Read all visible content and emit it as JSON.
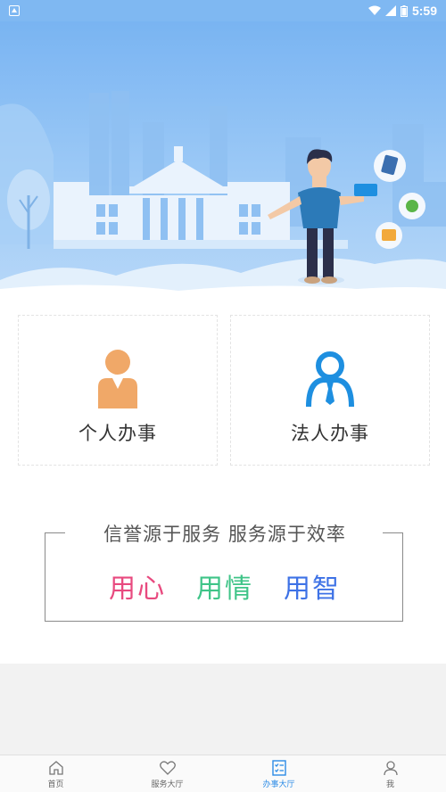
{
  "status_bar": {
    "time": "5:59"
  },
  "cards": [
    {
      "label": "个人办事",
      "icon": "person-icon",
      "color": "#f0a868"
    },
    {
      "label": "法人办事",
      "icon": "corporate-person-icon",
      "color": "#1e8fe0"
    }
  ],
  "slogan": {
    "title": "信誉源于服务 服务源于效率",
    "words": [
      {
        "text": "用心",
        "color": "#e84a7f"
      },
      {
        "text": "用情",
        "color": "#3fc488"
      },
      {
        "text": "用智",
        "color": "#3e72e6"
      }
    ]
  },
  "tabbar": {
    "items": [
      {
        "label": "首页",
        "icon": "home-icon",
        "active": false
      },
      {
        "label": "服务大厅",
        "icon": "heart-icon",
        "active": false
      },
      {
        "label": "办事大厅",
        "icon": "checklist-icon",
        "active": true
      },
      {
        "label": "我",
        "icon": "user-icon",
        "active": false
      }
    ],
    "active_color": "#2b8be6"
  }
}
